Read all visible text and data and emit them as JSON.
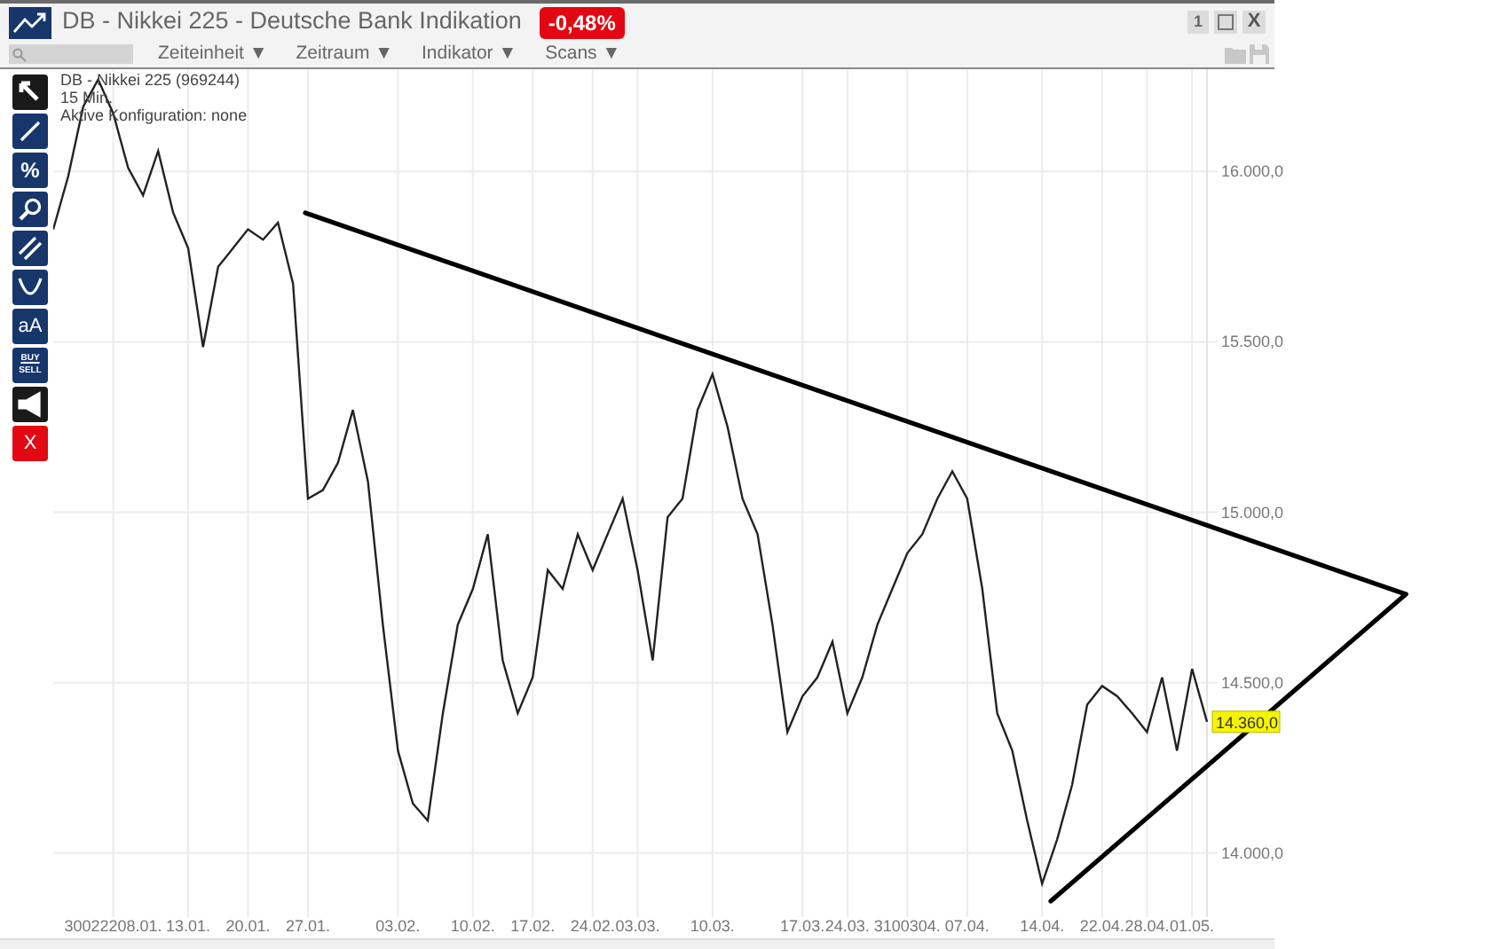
{
  "window": {
    "title": "DB - Nikkei 225 - Deutsche Bank Indikation",
    "change": "-0,48%",
    "buttons": [
      {
        "kind": "number",
        "label": "1"
      },
      {
        "kind": "maximize"
      },
      {
        "kind": "close",
        "label": "X"
      }
    ]
  },
  "toolbar": {
    "menus": [
      "Zeiteinheit ▼",
      "Zeitraum ▼",
      "Indikator ▼",
      "Scans ▼"
    ],
    "actions": [
      {
        "kind": "folder"
      },
      {
        "kind": "save"
      }
    ]
  },
  "tools": [
    {
      "kind": "pointer"
    },
    {
      "kind": "line"
    },
    {
      "kind": "percent",
      "label": "%"
    },
    {
      "kind": "zoom"
    },
    {
      "kind": "parallel"
    },
    {
      "kind": "curve"
    },
    {
      "kind": "text",
      "label": "aA"
    },
    {
      "kind": "buysell",
      "labels": [
        "BUY",
        "SELL"
      ]
    },
    {
      "kind": "megaphone"
    },
    {
      "kind": "delete",
      "label": "X"
    }
  ],
  "chart": {
    "info": [
      "DB - Nikkei 225 (969244)",
      "15 Min.",
      "Aktive Konfiguration: none"
    ],
    "price_label": "14.360,0",
    "chart_data": {
      "type": "line",
      "grid": true,
      "ylim": [
        13812,
        16300
      ],
      "categories": [
        null,
        null,
        null,
        null,
        "30022208.01.",
        null,
        null,
        null,
        null,
        "13.01.",
        null,
        null,
        null,
        "20.01.",
        null,
        null,
        null,
        "27.01.",
        null,
        null,
        null,
        null,
        null,
        "03.02.",
        null,
        null,
        null,
        null,
        "10.02.",
        null,
        null,
        null,
        "17.02.",
        null,
        null,
        null,
        "24.02.",
        null,
        null,
        "03.03.",
        null,
        null,
        null,
        null,
        "10.03.",
        null,
        null,
        null,
        null,
        null,
        "17.03.",
        null,
        null,
        "24.03.",
        null,
        null,
        null,
        "3100304.",
        null,
        null,
        null,
        "07.04.",
        null,
        null,
        null,
        null,
        "14.04.",
        null,
        null,
        null,
        "22.04.",
        null,
        null,
        "28.04.",
        null,
        null,
        "01.05.",
        null
      ],
      "values": [
        15830,
        15985,
        16190,
        16270,
        16170,
        16010,
        15930,
        16060,
        15880,
        15775,
        15485,
        15720,
        15775,
        15830,
        15800,
        15850,
        15670,
        15040,
        15065,
        15145,
        15300,
        15090,
        14670,
        14300,
        14145,
        14095,
        14410,
        14670,
        14775,
        14935,
        14565,
        14410,
        14515,
        14830,
        14775,
        14935,
        14830,
        14935,
        15040,
        14830,
        14565,
        14985,
        15040,
        15300,
        15405,
        15250,
        15040,
        14935,
        14670,
        14355,
        14460,
        14515,
        14620,
        14410,
        14515,
        14670,
        14775,
        14880,
        14935,
        15040,
        15120,
        15040,
        14775,
        14410,
        14300,
        14095,
        13910,
        14040,
        14200,
        14435,
        14490,
        14460,
        14410,
        14355,
        14515,
        14300,
        14540,
        14385
      ],
      "yticks": [
        {
          "value": 14000,
          "label": "14.000,0"
        },
        {
          "value": 14500,
          "label": "14.500,0"
        },
        {
          "value": 15000,
          "label": "15.000,0"
        },
        {
          "value": 15500,
          "label": "15.500,0"
        },
        {
          "value": 16000,
          "label": "16.000,0"
        }
      ]
    }
  }
}
